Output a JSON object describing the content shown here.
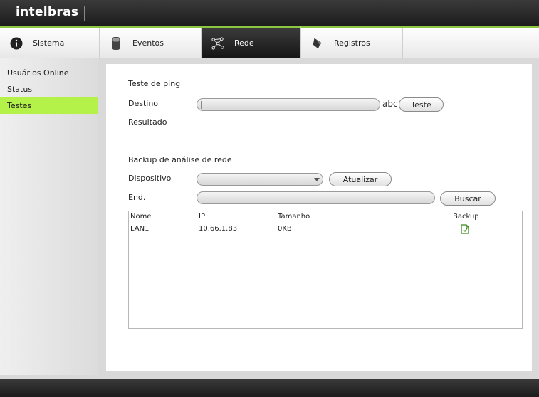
{
  "header": {
    "logo": "intelbras"
  },
  "tabs": [
    {
      "label": "Sistema",
      "icon": "info-icon",
      "active": false
    },
    {
      "label": "Eventos",
      "icon": "events-icon",
      "active": false
    },
    {
      "label": "Rede",
      "icon": "network-icon",
      "active": true
    },
    {
      "label": "Registros",
      "icon": "registros-icon",
      "active": false
    }
  ],
  "sidebar": {
    "items": [
      {
        "label": "Usuários Online",
        "active": false
      },
      {
        "label": "Status",
        "active": false
      },
      {
        "label": "Testes",
        "active": true
      }
    ]
  },
  "ping": {
    "section_title": "Teste de ping",
    "destino_label": "Destino",
    "destino_value": "",
    "input_mode": "abc",
    "teste_button": "Teste",
    "resultado_label": "Resultado",
    "resultado_value": ""
  },
  "backup": {
    "section_title": "Backup de análise de rede",
    "dispositivo_label": "Dispositivo",
    "dispositivo_value": "",
    "atualizar_button": "Atualizar",
    "end_label": "End.",
    "end_value": "",
    "buscar_button": "Buscar",
    "table": {
      "headers": {
        "nome": "Nome",
        "ip": "IP",
        "tamanho": "Tamanho",
        "backup": "Backup"
      },
      "rows": [
        {
          "nome": "LAN1",
          "ip": "10.66.1.83",
          "tamanho": "0KB"
        }
      ]
    }
  },
  "colors": {
    "accent_green": "#8dc63f",
    "active_sidebar": "#b4f24a",
    "header_dark": "#1d1d1d"
  }
}
